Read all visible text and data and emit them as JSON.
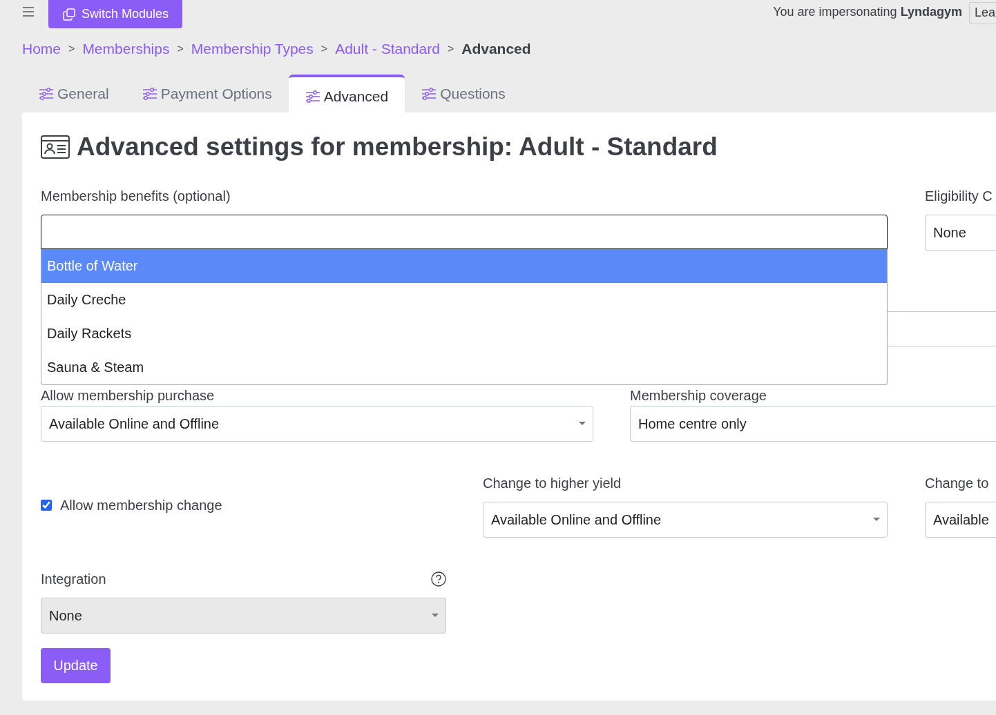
{
  "top_bar": {
    "switch_button": "Switch Modules",
    "impersonation": "You are impersonating **Lyndagym**",
    "leave_button": "Lea"
  },
  "breadcrumb": [
    {
      "label": "Home",
      "current": false
    },
    {
      "separator": ">",
      "label": "Memberships",
      "current": false
    },
    {
      "separator": ">",
      "label": "Membership Types",
      "current": false
    },
    {
      "separator": ">",
      "label": "Adult - Standard",
      "current": false
    },
    {
      "separator": ">",
      "label": "Advanced",
      "current": true
    }
  ],
  "tabs": [
    {
      "label": "General",
      "selected": false
    },
    {
      "label": "Payment Options",
      "selected": false
    },
    {
      "label": "Advanced",
      "selected": true
    },
    {
      "label": "Questions",
      "selected": false
    }
  ],
  "heading": "Advanced settings for membership: Adult - Standard",
  "benefits": {
    "label": "Membership benefits (optional)",
    "options": [
      {
        "label": "Bottle of Water",
        "selected": true
      },
      {
        "label": "Daily Creche",
        "selected": false
      },
      {
        "label": "Daily Rackets",
        "selected": false
      },
      {
        "label": "Sauna & Steam",
        "selected": false
      }
    ]
  },
  "eligibility": {
    "label": "Eligibility C",
    "value": "None"
  },
  "purchase": {
    "label": "Allow membership purchase",
    "value": "Available Online and Offline"
  },
  "coverage": {
    "label": "Membership coverage",
    "value": "Home centre only"
  },
  "change": {
    "label": "Allow membership change",
    "checked": true
  },
  "higher_yield": {
    "label": "Change to higher yield",
    "value": "Available Online and Offline"
  },
  "lower_yield": {
    "label": "Change to",
    "value": "Available"
  },
  "integration": {
    "label": "Integration",
    "value": "None",
    "disabled": true
  },
  "update_button": "Update"
}
